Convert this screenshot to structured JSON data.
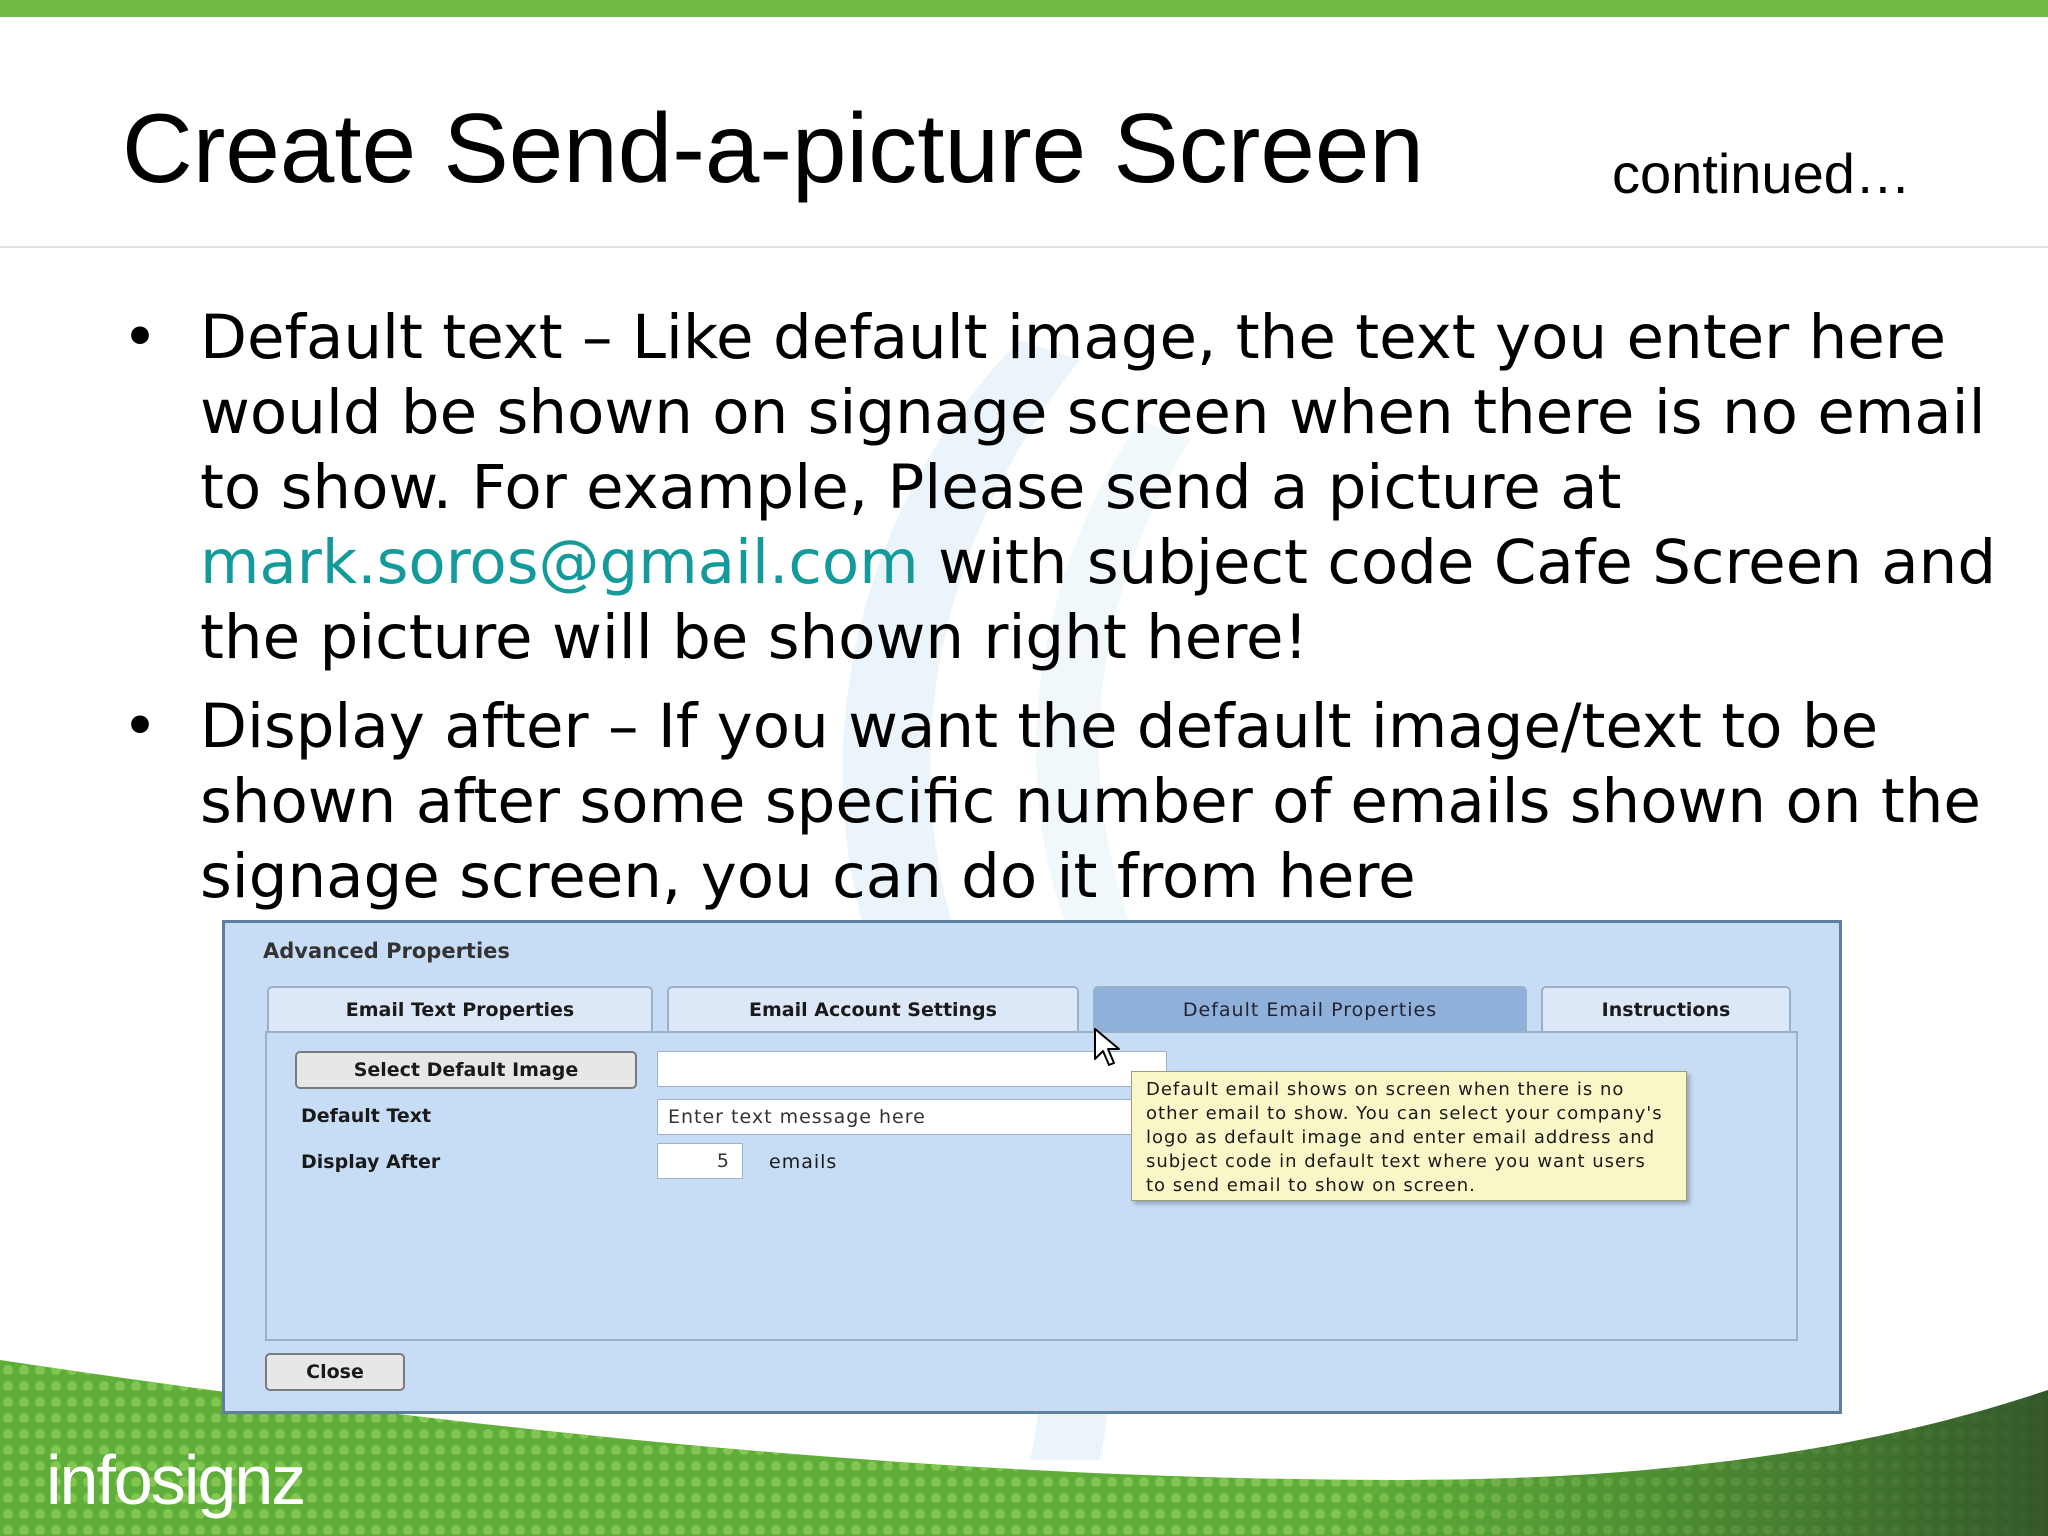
{
  "slide": {
    "title": "Create Send-a-picture Screen",
    "title_suffix": "continued…",
    "bullet_1_a": "Default text – Like default image, the text you enter here would be shown on signage screen when there is no email to show. For example, Please send a picture at ",
    "bullet_1_link": "mark.soros@gmail.com",
    "bullet_1_b": " with subject code Cafe Screen and the picture will be shown right here!",
    "bullet_2": "Display after – If you want the default image/text to be shown after some specific number of emails shown on the signage screen, you can do it from here",
    "link_color": "#159a9c",
    "accent_color": "#6fbb44",
    "logo_text": "infosignz"
  },
  "dialog": {
    "title": "Advanced Properties",
    "tabs": [
      {
        "label": "Email Text Properties",
        "active": false
      },
      {
        "label": "Email Account Settings",
        "active": false
      },
      {
        "label": "Default Email Properties",
        "active": true
      },
      {
        "label": "Instructions",
        "active": false
      }
    ],
    "select_image_button": "Select Default Image",
    "image_field_value": "",
    "default_text_label": "Default Text",
    "default_text_value": "Enter text message here",
    "display_after_label": "Display After",
    "display_after_value": "5",
    "display_after_unit": "emails",
    "tooltip": "Default email shows on screen when there is no other email to show. You can select your company's logo as default image and enter email address and subject code in default text where you want users to send email to show on screen.",
    "close_button": "Close"
  }
}
